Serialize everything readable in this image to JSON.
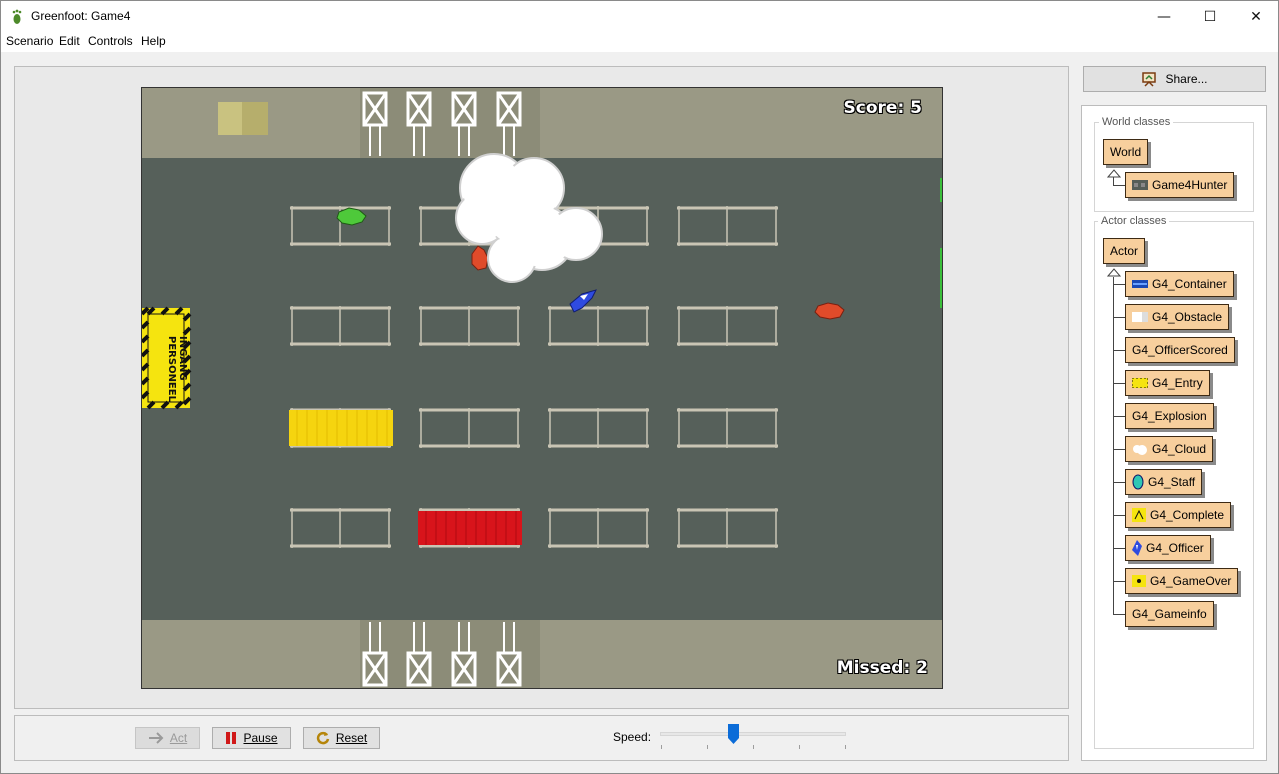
{
  "window": {
    "title": "Greenfoot: Game4",
    "minimize": "—",
    "maximize": "☐",
    "close": "✕"
  },
  "menu": [
    "Scenario",
    "Edit",
    "Controls",
    "Help"
  ],
  "world": {
    "score": "Score: 5",
    "missed": "Missed: 2",
    "entry_sign": "INGANG\nPERSONEEL"
  },
  "controls": {
    "act": "Act",
    "pause": "Pause",
    "reset": "Reset",
    "speed_label": "Speed:",
    "speed_value": 0.4
  },
  "share": {
    "label": "Share..."
  },
  "world_classes": {
    "title": "World classes",
    "items": [
      "World",
      "Game4Hunter"
    ]
  },
  "actor_classes": {
    "title": "Actor classes",
    "root": "Actor",
    "items": [
      "G4_Container",
      "G4_Obstacle",
      "G4_OfficerScored",
      "G4_Entry",
      "G4_Explosion",
      "G4_Cloud",
      "G4_Staff",
      "G4_Complete",
      "G4_Officer",
      "G4_GameOver",
      "G4_Gameinfo"
    ]
  },
  "colors": {
    "class_box": "#f7cf9d",
    "road": "#56605a",
    "sidewalk": "#9a9985",
    "yellow_container": "#f5d40f",
    "red_container": "#d8141b"
  }
}
